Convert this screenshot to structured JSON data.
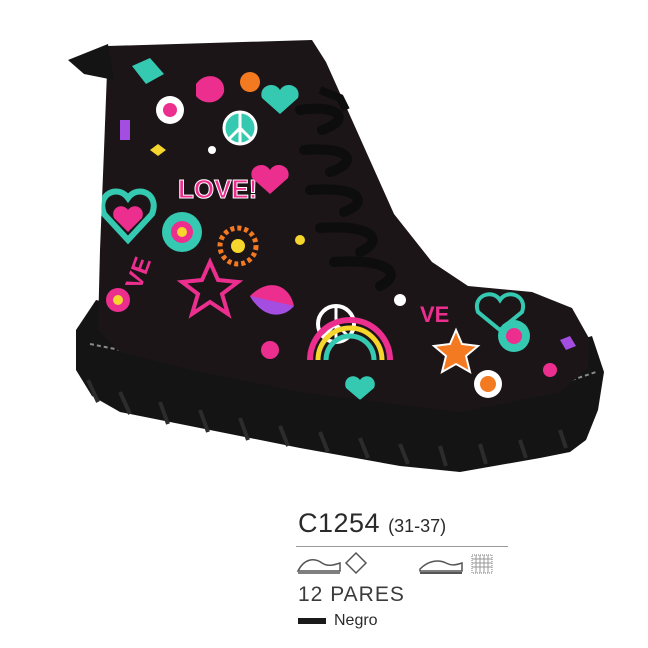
{
  "product": {
    "code": "C1254",
    "size_range": "(31-37)",
    "pairs": "12 PARES",
    "color_name": "Negro",
    "color_swatch": "#1a1a1a"
  },
  "icons": [
    "upper-material-icon",
    "diamond-icon",
    "sole-material-icon",
    "textile-lining-icon"
  ],
  "palette": {
    "boot_base": "#1c1518",
    "sole": "#141414",
    "pink": "#ec2f8f",
    "teal": "#34c9b0",
    "purple": "#7b3fd1",
    "orange": "#f47a21",
    "yellow": "#f6d52c",
    "white": "#ffffff"
  }
}
